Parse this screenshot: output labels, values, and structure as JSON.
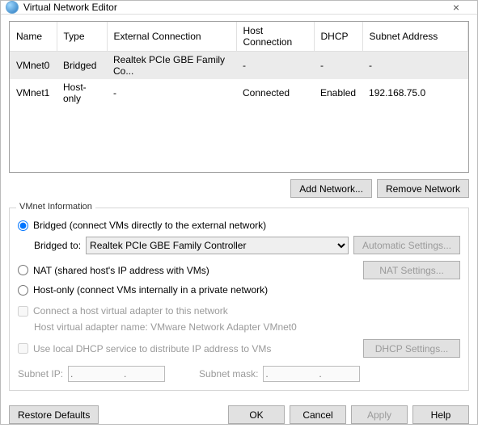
{
  "titlebar": {
    "title": "Virtual Network Editor",
    "close": "×"
  },
  "table": {
    "headers": {
      "name": "Name",
      "type": "Type",
      "ext": "External Connection",
      "host": "Host Connection",
      "dhcp": "DHCP",
      "subnet": "Subnet Address"
    },
    "rows": [
      {
        "name": "VMnet0",
        "type": "Bridged",
        "ext": "Realtek PCIe GBE Family Co...",
        "host": "-",
        "dhcp": "-",
        "subnet": "-",
        "selected": true
      },
      {
        "name": "VMnet1",
        "type": "Host-only",
        "ext": "-",
        "host": "Connected",
        "dhcp": "Enabled",
        "subnet": "192.168.75.0",
        "selected": false
      }
    ]
  },
  "buttons": {
    "add_network": "Add Network...",
    "remove_network": "Remove Network",
    "automatic_settings": "Automatic Settings...",
    "nat_settings": "NAT Settings...",
    "dhcp_settings": "DHCP Settings...",
    "restore_defaults": "Restore Defaults",
    "ok": "OK",
    "cancel": "Cancel",
    "apply": "Apply",
    "help": "Help"
  },
  "info": {
    "group_title": "VMnet Information",
    "bridged_label": "Bridged (connect VMs directly to the external network)",
    "bridged_to_label": "Bridged to:",
    "bridged_to_value": "Realtek PCIe GBE Family Controller",
    "nat_label": "NAT (shared host's IP address with VMs)",
    "hostonly_label": "Host-only (connect VMs internally in a private network)",
    "connect_host_adapter": "Connect a host virtual adapter to this network",
    "host_adapter_name_label": "Host virtual adapter name: VMware Network Adapter VMnet0",
    "use_dhcp": "Use local DHCP service to distribute IP address to VMs",
    "subnet_ip_label": "Subnet IP:",
    "subnet_mask_label": "Subnet mask:",
    "ip_placeholder": ".        .        ."
  }
}
